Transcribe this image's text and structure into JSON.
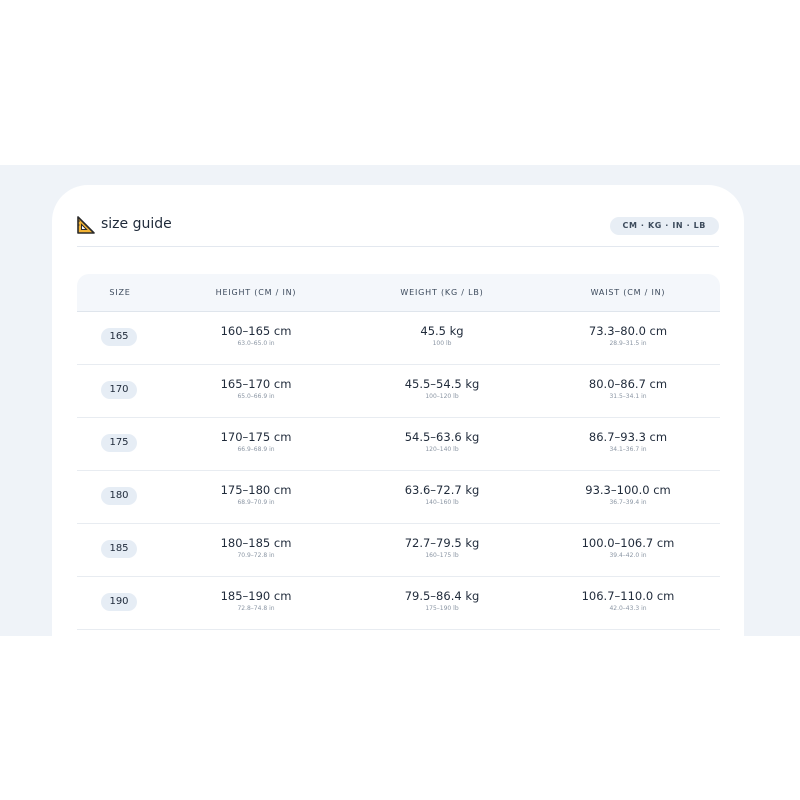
{
  "header": {
    "title": "size guide",
    "icon": "set-square-ruler-icon",
    "units_badge": "CM · KG · IN · LB"
  },
  "table": {
    "columns": [
      "SIZE",
      "HEIGHT (CM / IN)",
      "WEIGHT (KG / LB)",
      "WAIST (CM / IN)"
    ],
    "rows": [
      {
        "size": "165",
        "height": "160–165 cm",
        "height_in": "63.0–65.0 in",
        "weight": "45.5 kg",
        "weight_lb": "100 lb",
        "waist": "73.3–80.0 cm",
        "waist_in": "28.9–31.5 in"
      },
      {
        "size": "170",
        "height": "165–170 cm",
        "height_in": "65.0–66.9 in",
        "weight": "45.5–54.5 kg",
        "weight_lb": "100–120 lb",
        "waist": "80.0–86.7 cm",
        "waist_in": "31.5–34.1 in"
      },
      {
        "size": "175",
        "height": "170–175 cm",
        "height_in": "66.9–68.9 in",
        "weight": "54.5–63.6 kg",
        "weight_lb": "120–140 lb",
        "waist": "86.7–93.3 cm",
        "waist_in": "34.1–36.7 in"
      },
      {
        "size": "180",
        "height": "175–180 cm",
        "height_in": "68.9–70.9 in",
        "weight": "63.6–72.7 kg",
        "weight_lb": "140–160 lb",
        "waist": "93.3–100.0 cm",
        "waist_in": "36.7–39.4 in"
      },
      {
        "size": "185",
        "height": "180–185 cm",
        "height_in": "70.9–72.8 in",
        "weight": "72.7–79.5 kg",
        "weight_lb": "160–175 lb",
        "waist": "100.0–106.7 cm",
        "waist_in": "39.4–42.0 in"
      },
      {
        "size": "190",
        "height": "185–190 cm",
        "height_in": "72.8–74.8 in",
        "weight": "79.5–86.4 kg",
        "weight_lb": "175–190 lb",
        "waist": "106.7–110.0 cm",
        "waist_in": "42.0–43.3 in"
      }
    ]
  }
}
